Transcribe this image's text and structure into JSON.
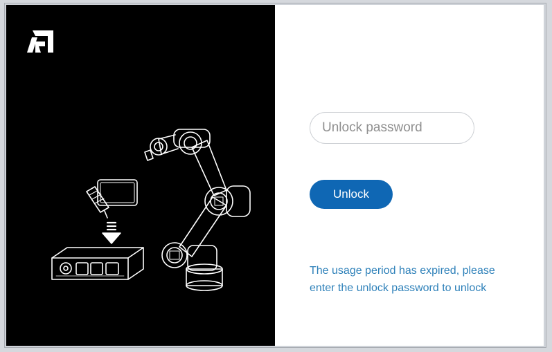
{
  "left_panel": {
    "logo_icon": "company-logo-icon",
    "illustration": "robot-arm-with-controller-illustration"
  },
  "unlock_form": {
    "password_placeholder": "Unlock password",
    "password_value": "",
    "unlock_label": "Unlock",
    "message_line1": "The usage period has expired, please",
    "message_line2": "enter the unlock password to unlock"
  },
  "colors": {
    "left_background": "#000000",
    "button_background": "#0f67b4",
    "message_text": "#2d80b9"
  }
}
